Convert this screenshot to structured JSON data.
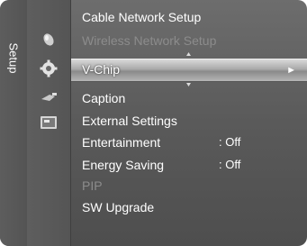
{
  "sidebar": {
    "label": "Setup"
  },
  "icons": [
    "picture-icon",
    "setup-gear-icon",
    "input-plug-icon",
    "application-icon"
  ],
  "menu": {
    "items": [
      {
        "label": "Cable Network Setup",
        "value": "",
        "enabled": true
      },
      {
        "label": "Wireless Network Setup",
        "value": "",
        "enabled": false
      },
      {
        "label": "V-Chip",
        "value": "",
        "enabled": true,
        "selected": true
      },
      {
        "label": "Caption",
        "value": "",
        "enabled": true
      },
      {
        "label": "External Settings",
        "value": "",
        "enabled": true
      },
      {
        "label": "Entertainment",
        "value": ": Off",
        "enabled": true
      },
      {
        "label": "Energy Saving",
        "value": ": Off",
        "enabled": true
      },
      {
        "label": "PIP",
        "value": "",
        "enabled": false
      },
      {
        "label": "SW Upgrade",
        "value": "",
        "enabled": true
      }
    ],
    "submenu_arrow": "►"
  }
}
